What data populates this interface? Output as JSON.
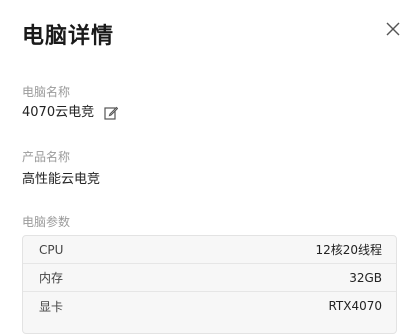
{
  "dialog": {
    "title": "电脑详情"
  },
  "computer_name": {
    "label": "电脑名称",
    "value": "4070云电竞"
  },
  "product_name": {
    "label": "产品名称",
    "value": "高性能云电竞"
  },
  "computer_params": {
    "label": "电脑参数",
    "rows": [
      {
        "name": "CPU",
        "value": "12核20线程"
      },
      {
        "name": "内存",
        "value": "32GB"
      },
      {
        "name": "显卡",
        "value": "RTX4070"
      }
    ]
  },
  "icons": {
    "close": "close-icon",
    "edit": "edit-icon"
  },
  "colors": {
    "label": "#9a9a9a",
    "text": "#222222",
    "params_bg": "#f7f7f7",
    "border": "#e3e3e3"
  }
}
